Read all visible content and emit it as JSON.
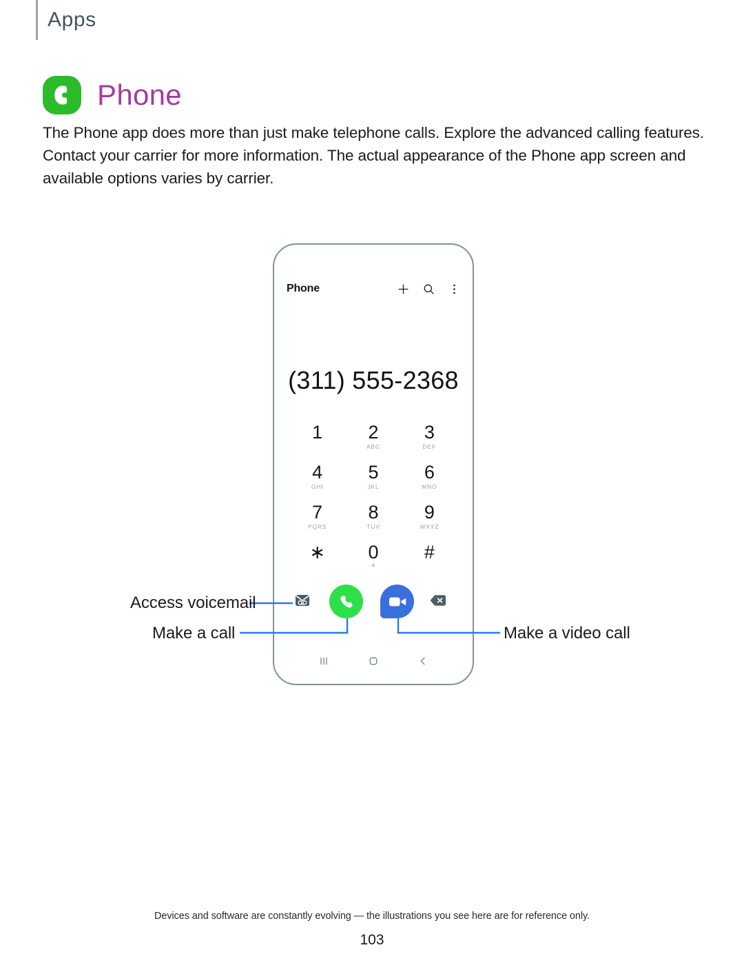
{
  "running_head": {
    "label": "Apps"
  },
  "app_heading": {
    "icon": "phone-app-icon",
    "title": "Phone",
    "icon_color": "#2bbb2b",
    "title_color": "#a23ca2"
  },
  "intro": {
    "paragraph": "The Phone app does more than just make telephone calls. Explore the advanced calling features. Contact your carrier for more information. The actual appearance of the Phone app screen and available options varies by carrier."
  },
  "phone": {
    "appbar": {
      "title": "Phone",
      "actions": [
        {
          "name": "add-contact-icon",
          "glyph": "+"
        },
        {
          "name": "search-icon",
          "glyph": "search"
        },
        {
          "name": "more-options-icon",
          "glyph": "kebab"
        }
      ]
    },
    "dialed_number": "(311) 555-2368",
    "keypad": [
      {
        "digit": "1",
        "letters": ""
      },
      {
        "digit": "2",
        "letters": "ABC"
      },
      {
        "digit": "3",
        "letters": "DEF"
      },
      {
        "digit": "4",
        "letters": "GHI"
      },
      {
        "digit": "5",
        "letters": "JKL"
      },
      {
        "digit": "6",
        "letters": "MNO"
      },
      {
        "digit": "7",
        "letters": "PQRS"
      },
      {
        "digit": "8",
        "letters": "TUV"
      },
      {
        "digit": "9",
        "letters": "WXYZ"
      },
      {
        "digit": "∗",
        "letters": ""
      },
      {
        "digit": "0",
        "letters": "+"
      },
      {
        "digit": "#",
        "letters": ""
      }
    ],
    "actions": {
      "voicemail": "voicemail-icon",
      "call": "call-button",
      "video_call": "video-call-button",
      "backspace": "backspace-icon",
      "call_color": "#2de04a",
      "video_color": "#3a6fe0"
    },
    "navbar": [
      {
        "name": "recents-icon"
      },
      {
        "name": "home-icon"
      },
      {
        "name": "back-icon"
      }
    ]
  },
  "callouts": {
    "line_color": "#2979e8",
    "items": [
      {
        "name": "access-voicemail",
        "label": "Access voicemail"
      },
      {
        "name": "make-a-call",
        "label": "Make a call"
      },
      {
        "name": "make-a-video-call",
        "label": "Make a video call"
      }
    ]
  },
  "footer": {
    "note": "Devices and software are constantly evolving — the illustrations you see here are for reference only.",
    "page_number": "103"
  }
}
